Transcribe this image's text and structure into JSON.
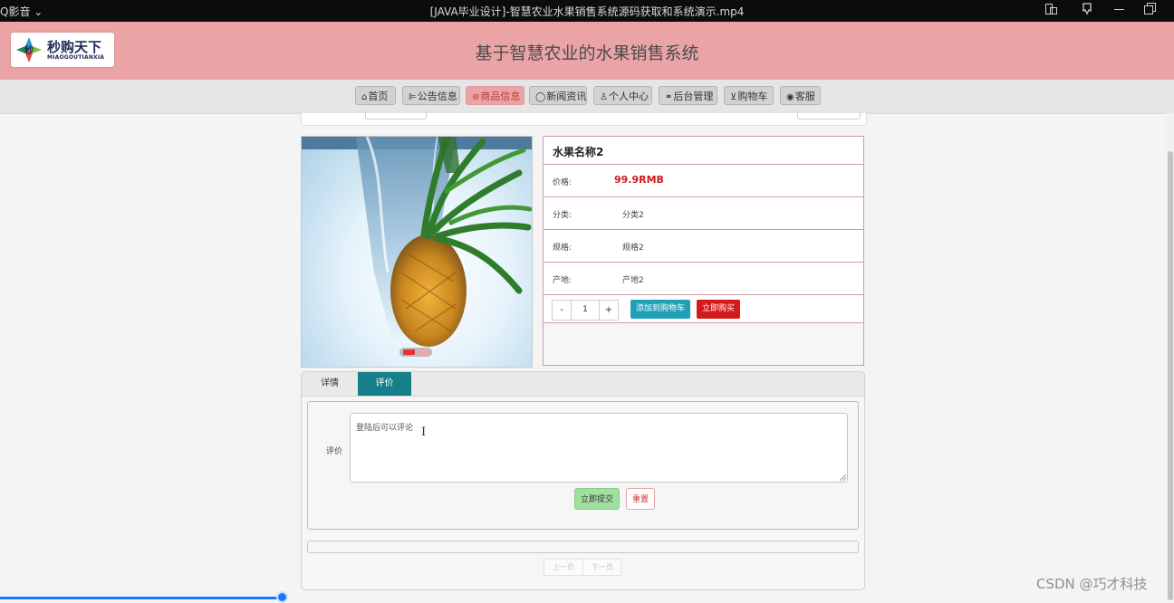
{
  "player": {
    "app_name": "Q影音",
    "file_title": "[JAVA毕业设计]-智慧农业水果销售系统源码获取和系统演示.mp4",
    "progress_fraction": 0.24
  },
  "header": {
    "logo_brand_cn": "秒购天下",
    "logo_brand_en": "MIAOGOUTIANXIA",
    "site_title": "基于智慧农业的水果销售系统"
  },
  "nav": {
    "items": [
      {
        "label": "首页",
        "icon": "home-icon"
      },
      {
        "label": "公告信息",
        "icon": "megaphone-icon"
      },
      {
        "label": "商品信息",
        "icon": "gift-icon",
        "active": true
      },
      {
        "label": "新闻资讯",
        "icon": "chat-icon"
      },
      {
        "label": "个人中心",
        "icon": "user-icon"
      },
      {
        "label": "后台管理",
        "icon": "link-icon"
      },
      {
        "label": "购物车",
        "icon": "cart-icon"
      },
      {
        "label": "客服",
        "icon": "support-icon"
      }
    ]
  },
  "product": {
    "name": "水果名称2",
    "price_label": "价格:",
    "price": "99.9RMB",
    "category_label": "分类:",
    "category": "分类2",
    "spec_label": "规格:",
    "spec": "规格2",
    "origin_label": "产地:",
    "origin": "产地2",
    "qty_minus": "-",
    "qty_value": "1",
    "qty_plus": "+",
    "add_to_cart": "添加到购物车",
    "buy_now": "立即购买",
    "carousel_active_color": "#e83232",
    "carousel_inactive_color": "#f0a6a8"
  },
  "tabs": {
    "detail": "详情",
    "review": "评价"
  },
  "review_form": {
    "label": "评价",
    "placeholder": "登陆后可以评论",
    "submit": "立即提交",
    "reset": "重置"
  },
  "pager": {
    "prev": "上一页",
    "next": "下一页"
  },
  "watermark": "CSDN @巧才科技",
  "colors": {
    "header_bg": "#eba4a6",
    "tab_active": "#167f8a",
    "price": "#d01a1a",
    "cart_button": "#22a0b8",
    "buy_button": "#d21c1c",
    "progress": "#1677ff"
  }
}
